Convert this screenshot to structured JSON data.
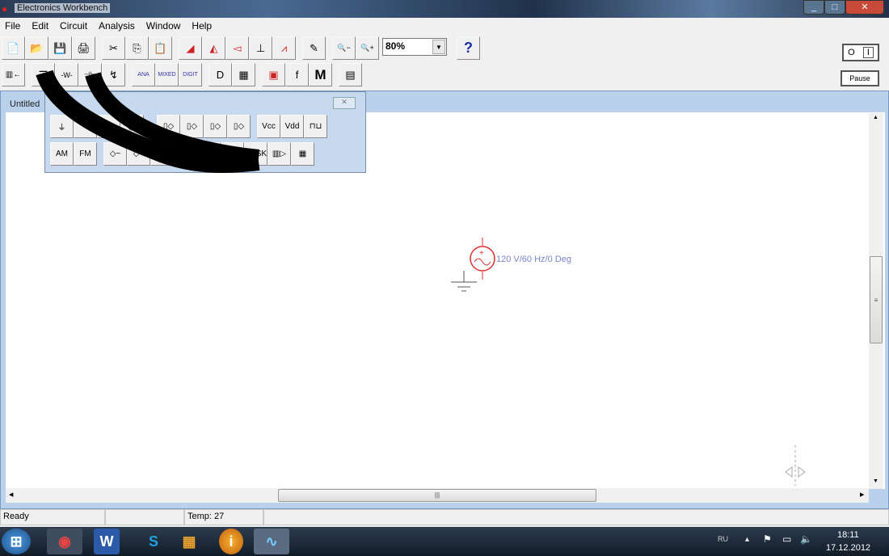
{
  "window": {
    "title": "Electronics Workbench",
    "min": "_",
    "max": "□",
    "close": "✕"
  },
  "menu": [
    "File",
    "Edit",
    "Circuit",
    "Analysis",
    "Window",
    "Help"
  ],
  "toolbar1": [
    "📄",
    "📂",
    "💾",
    "🖨",
    "✂",
    "⎘",
    "📋",
    "◢",
    "◭",
    "◅",
    "⊥",
    "⩘",
    "✎",
    "🔍−",
    "🔍+"
  ],
  "zoom": {
    "value": "80%",
    "arrow": "▼"
  },
  "help": "?",
  "toolbar2": [
    "▥←",
    "☰",
    "-W-",
    "⊣⊢",
    "↯",
    "ANA",
    "MIXED",
    "DIGIT",
    "D",
    "▦",
    "▣",
    "f",
    "M",
    "▤"
  ],
  "power_switch": {
    "off": "O",
    "on": "I"
  },
  "pause_label": "Pause",
  "child": {
    "title": "Untitled"
  },
  "parts_bin": {
    "close": "✕",
    "row1": [
      "⏚",
      "",
      "◯",
      "◯",
      "▯◇",
      "▯◇",
      "▯◇",
      "▯◇",
      "Vcc",
      "Vdd",
      "⊓⊔"
    ],
    "row2": [
      "AM",
      "FM",
      "◇~",
      "◇~",
      "◇",
      "",
      "",
      "",
      "◇FSK",
      "▥▷",
      "▦"
    ]
  },
  "circuit": {
    "source_label": "120 V/60 Hz/0 Deg",
    "source_color": "#e03030",
    "label_color": "#7a84d0"
  },
  "scroll": {
    "grip": "≡",
    "hgrip": "|||",
    "up": "▲",
    "down": "▼",
    "left": "◀",
    "right": "▶"
  },
  "status": {
    "ready": "Ready",
    "blank": "",
    "temp": "Temp:  27"
  },
  "taskbar": {
    "apps": [
      "⊞",
      "◉",
      "W",
      "S",
      "▦",
      "i",
      "∿"
    ],
    "lang": "RU",
    "time": "18:11",
    "date": "17.12.2012"
  }
}
